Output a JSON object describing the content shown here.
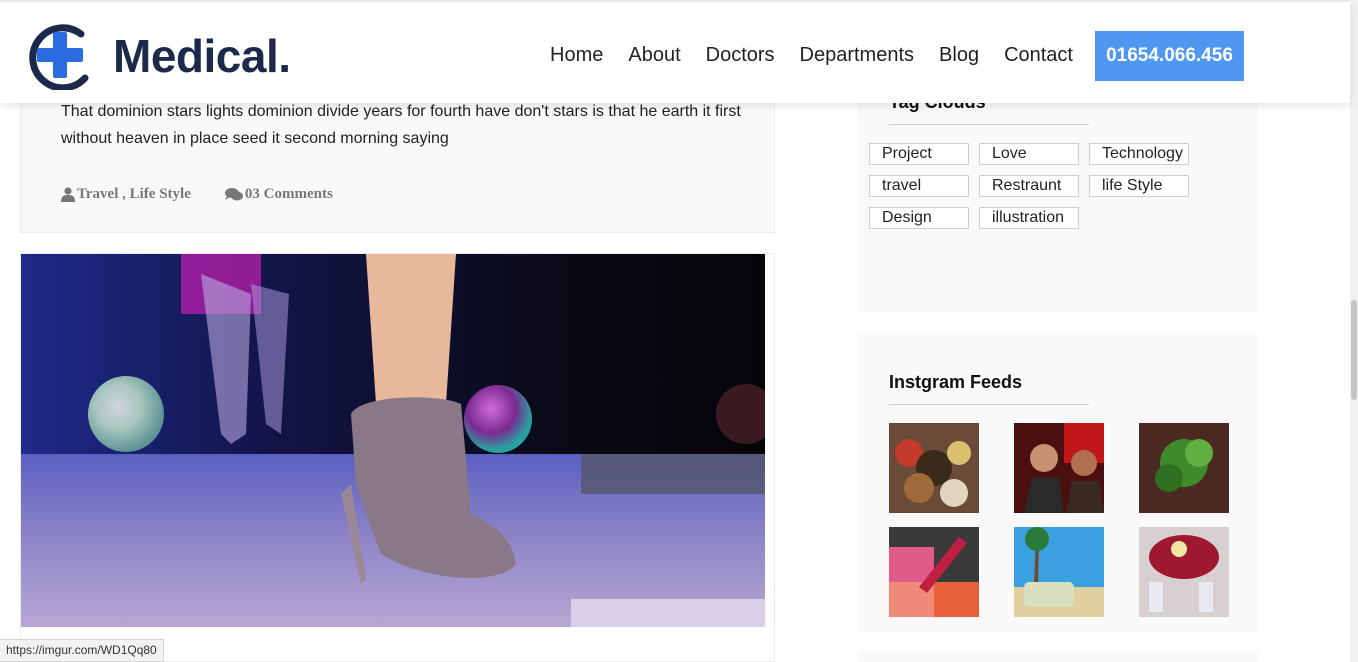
{
  "header": {
    "logo_text": "Medical.",
    "nav": [
      "Home",
      "About",
      "Doctors",
      "Departments",
      "Blog",
      "Contact"
    ],
    "phone": "01654.066.456"
  },
  "post": {
    "excerpt": "That dominion stars lights dominion divide years for fourth have don't stars is that he earth it first without heaven in place seed it second morning saying",
    "categories": "Travel , Life Style",
    "comments": "03 Comments"
  },
  "sidebar": {
    "tag_clouds_title": "Tag Clouds",
    "tags": [
      "Project",
      "Love",
      "Technology",
      "travel",
      "Restraunt",
      "life Style",
      "Design",
      "illustration"
    ],
    "instagram_title": "Instgram Feeds"
  },
  "status_bar": {
    "url": "https://imgur.com/WD1Qq80"
  },
  "colors": {
    "accent": "#4f97f0",
    "logo_navy": "#1b2a4a",
    "card_bg": "#f9f9f9"
  },
  "icons": [
    "logo-cross-icon",
    "user-icon",
    "comments-icon"
  ]
}
